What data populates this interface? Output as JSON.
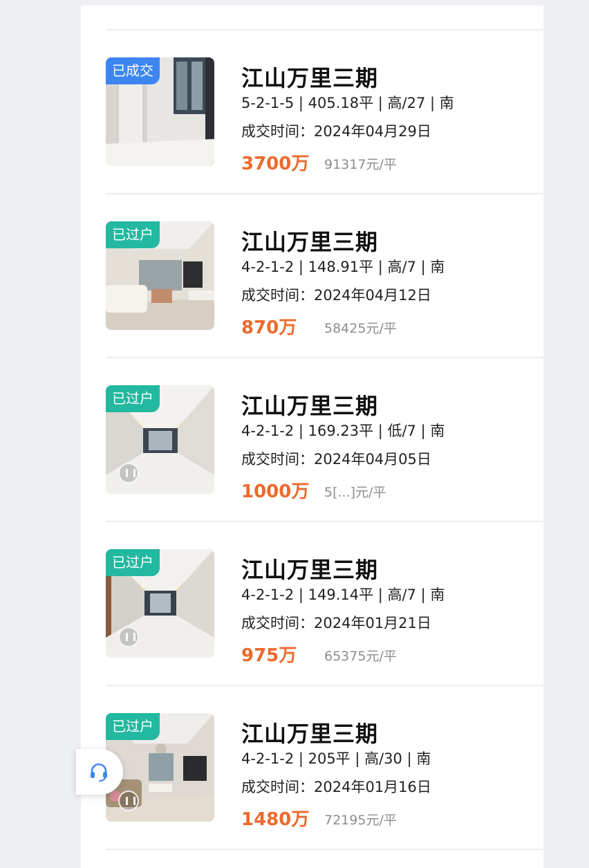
{
  "listings": [
    {
      "tag": "已成交",
      "tag_color": "#3d86f2",
      "name": "江山万里三期",
      "specs": "5-2-1-5 | 405.18平 | 高/27 | 南",
      "deal_date": "成交时间：2024年04月29日",
      "price": "3700万",
      "unit_price": "91317元/平",
      "thumb_icon": "room-photo"
    },
    {
      "tag": "已过户",
      "tag_color": "#23b8a0",
      "name": "江山万里三期",
      "specs": "4-2-1-2 | 148.91平 | 高/7 | 南",
      "deal_date": "成交时间：2024年04月12日",
      "price": "870万",
      "unit_price": "58425元/平",
      "thumb_icon": "living-room-photo"
    },
    {
      "tag": "已过户",
      "tag_color": "#23b8a0",
      "name": "江山万里三期",
      "specs": "4-2-1-2 | 169.23平 | 低/7 | 南",
      "deal_date": "成交时间：2024年04月05日",
      "price": "1000万",
      "unit_price": "5[...]元/平",
      "thumb_icon": "corridor-photo"
    },
    {
      "tag": "已过户",
      "tag_color": "#23b8a0",
      "name": "江山万里三期",
      "specs": "4-2-1-2 | 149.14平 | 高/7 | 南",
      "deal_date": "成交时间：2024年01月21日",
      "price": "975万",
      "unit_price": "65375元/平",
      "thumb_icon": "corridor-photo"
    },
    {
      "tag": "已过户",
      "tag_color": "#23b8a0",
      "name": "江山万里三期",
      "specs": "4-2-1-2 | 205平 | 高/30 | 南",
      "deal_date": "成交时间：2024年01月16日",
      "price": "1480万",
      "unit_price": "72195元/平",
      "thumb_icon": "living-room-photo"
    }
  ],
  "service_button": {
    "icon": "headset-icon"
  }
}
